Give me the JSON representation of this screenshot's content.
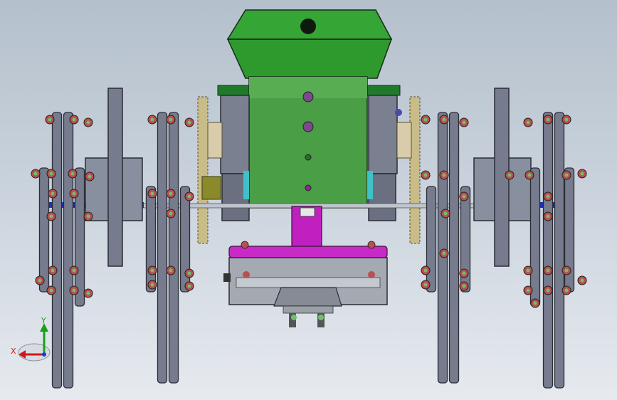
{
  "viewport": {
    "background_top": "#b4c0cc",
    "background_bottom": "#e6eaef"
  },
  "triad": {
    "x_label": "X",
    "y_label": "Y",
    "x_color": "#d01818",
    "y_color": "#18a018",
    "z_color": "#1840c8"
  },
  "colors": {
    "body_green": "#3f9a3f",
    "hopper_green": "#2e9a2e",
    "link_gray": "#767c8e",
    "link_edge": "#2a2d35",
    "bolt_red": "#b85050",
    "washer_green": "#6fbf6f",
    "axle_blue": "#1e2fb8",
    "gear_tan": "#c8bc88",
    "bracket_magenta": "#c020c0",
    "housing_gray": "#9ea3ac"
  }
}
